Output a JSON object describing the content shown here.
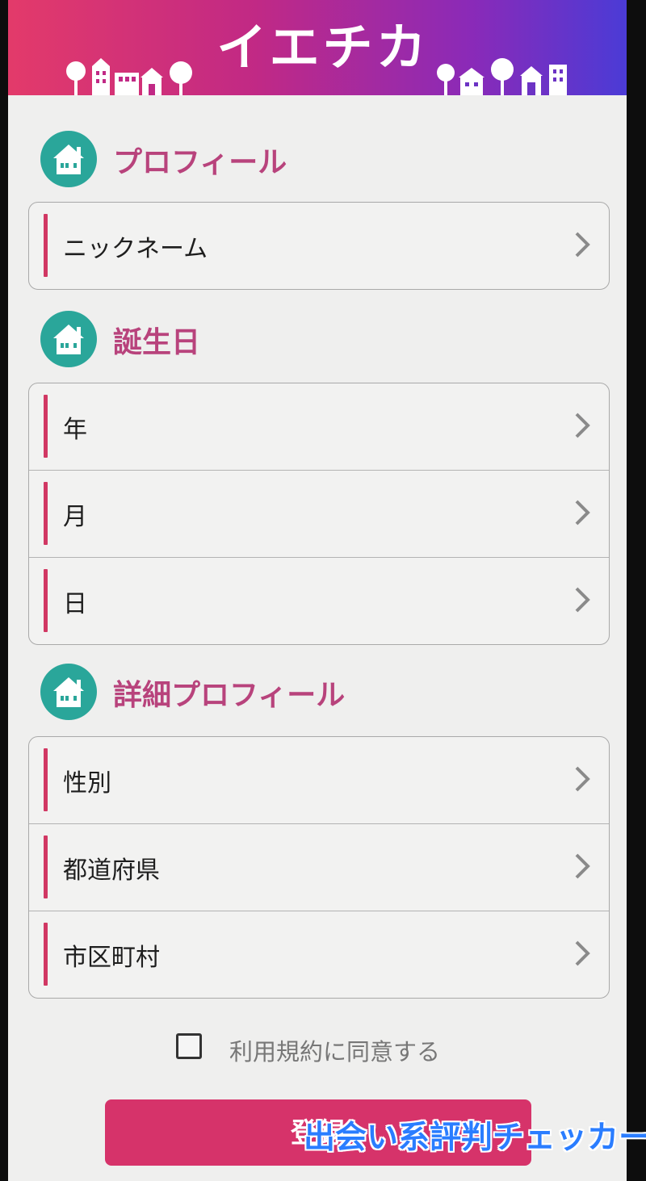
{
  "app": {
    "title": "イエチカ"
  },
  "sections": [
    {
      "title": "プロフィール",
      "items": [
        "ニックネーム"
      ]
    },
    {
      "title": "誕生日",
      "items": [
        "年",
        "月",
        "日"
      ]
    },
    {
      "title": "詳細プロフィール",
      "items": [
        "性別",
        "都道府県",
        "市区町村"
      ]
    }
  ],
  "agree": {
    "label": "利用規約に同意する",
    "checked": false
  },
  "submit": {
    "label": "登録"
  },
  "watermark": {
    "text": "出会い系評判チェッカー"
  },
  "colors": {
    "accent": "#d6336a",
    "section_title": "#b8437c",
    "icon_circle": "#2aa69a",
    "header_gradient_start": "#e33a6a",
    "header_gradient_end": "#4b3bd6"
  },
  "icons": {
    "section": "house-icon",
    "row": "chevron-right-icon"
  }
}
